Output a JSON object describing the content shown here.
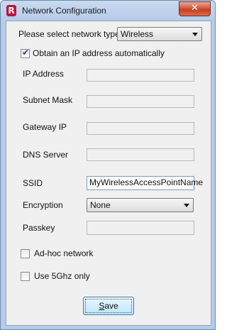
{
  "window": {
    "title": "Network Configuration",
    "app_icon": "R",
    "close_glyph": "✕"
  },
  "network_type": {
    "label": "Please select network type:",
    "selected": "Wireless"
  },
  "obtain_ip": {
    "label": "Obtain an IP address automatically",
    "checked": true
  },
  "fields": {
    "ip_address": {
      "label": "IP Address",
      "value": ""
    },
    "subnet_mask": {
      "label": "Subnet Mask",
      "value": ""
    },
    "gateway_ip": {
      "label": "Gateway IP",
      "value": ""
    },
    "dns_server": {
      "label": "DNS Server",
      "value": ""
    },
    "ssid": {
      "label": "SSID",
      "value": "MyWirelessAccessPointName"
    },
    "encryption": {
      "label": "Encryption",
      "selected": "None"
    },
    "passkey": {
      "label": "Passkey",
      "value": ""
    }
  },
  "adhoc": {
    "label": "Ad-hoc network",
    "checked": false
  },
  "five_ghz": {
    "label": "Use 5Ghz only",
    "checked": false
  },
  "save": {
    "label": "Save",
    "underline": "S",
    "rest": "ave"
  }
}
